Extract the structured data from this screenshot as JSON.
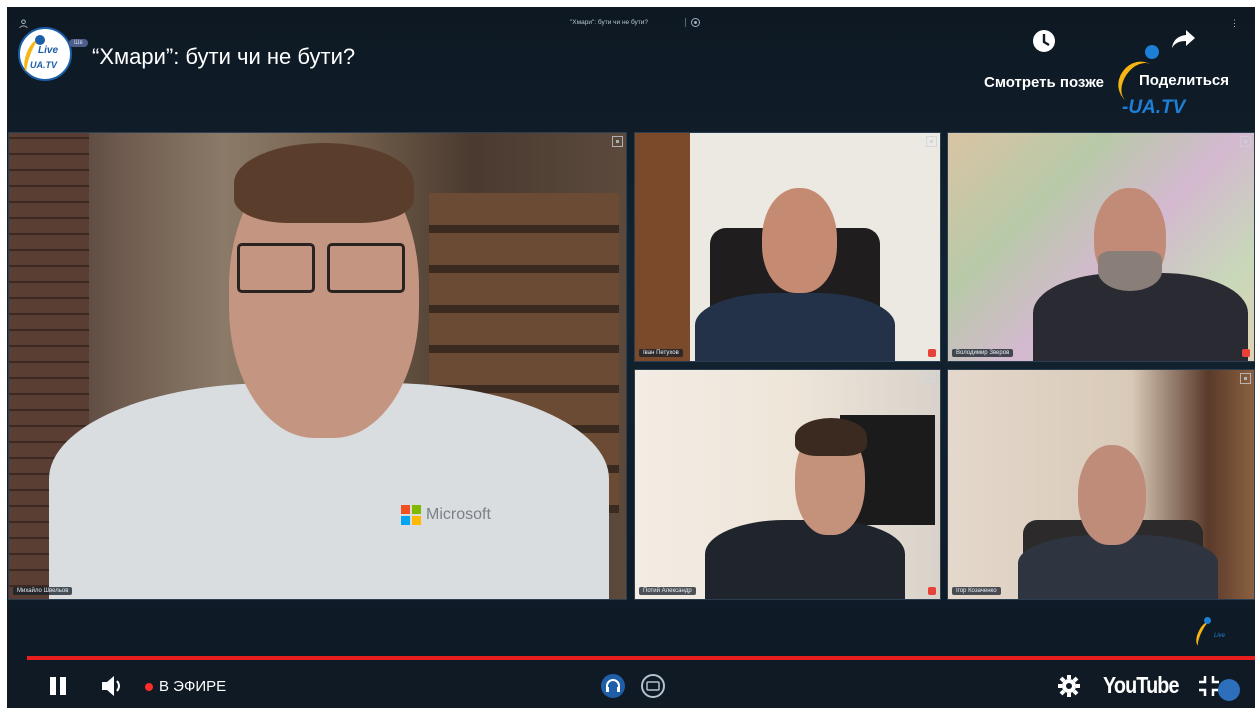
{
  "top": {
    "small_title": "\"Хмари\": бути чи не бути?",
    "title": "“Хмари”: бути чи не бути?",
    "host_chip": "Шв",
    "watch_later_label": "Смотреть позже",
    "share_label": "Поделиться",
    "logo_text_live": "Live",
    "logo_text_uatv": "UA.TV",
    "watermark_text": "-UA.TV"
  },
  "tiles": [
    {
      "name": "Михайло Швельов"
    },
    {
      "name": "Іван Петухов"
    },
    {
      "name": "Володимир Зверов"
    },
    {
      "name": "Потий Александр"
    },
    {
      "name": "Ігор Козаченко"
    }
  ],
  "shirt_logo": "Microsoft",
  "controls": {
    "live_label": "В ЭФИРЕ",
    "youtube_label": "YouTube"
  },
  "colors": {
    "progress": "#e81e1e",
    "background": "#0f1a24",
    "accent_blue": "#1e7fd6",
    "accent_yellow": "#f7b512"
  },
  "icons": [
    "pause-icon",
    "volume-icon",
    "live-dot-icon",
    "headset-icon",
    "caption-icon",
    "settings-icon",
    "exit-fullscreen-icon",
    "clock-icon",
    "share-icon"
  ]
}
